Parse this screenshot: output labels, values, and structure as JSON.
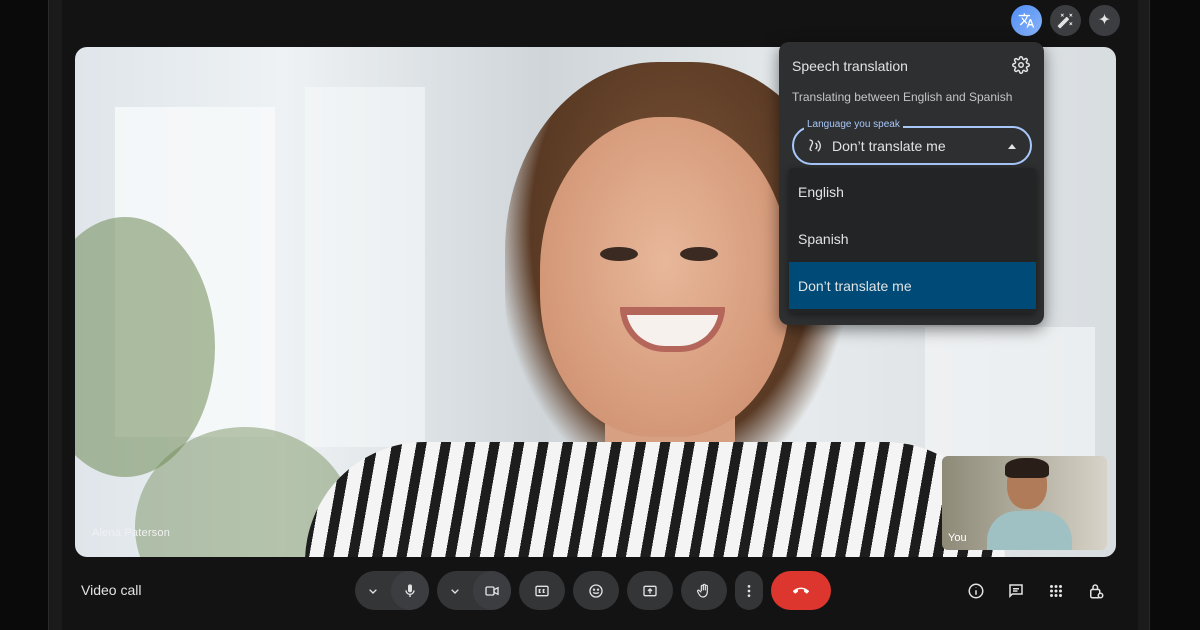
{
  "top_icons": [
    {
      "name": "translate-icon",
      "active": true
    },
    {
      "name": "magic-wand-icon",
      "active": false
    },
    {
      "name": "sparkle-icon",
      "active": false
    }
  ],
  "main_video": {
    "speaker_name": "Alena Paterson"
  },
  "self_view": {
    "label": "You"
  },
  "translation_panel": {
    "title": "Speech translation",
    "subtitle": "Translating between English and Spanish",
    "select_legend": "Language you speak",
    "select_value": "Don’t translate me",
    "options": [
      {
        "label": "English",
        "selected": false
      },
      {
        "label": "Spanish",
        "selected": false
      },
      {
        "label": "Don’t translate me",
        "selected": true
      }
    ]
  },
  "bottom_bar": {
    "meeting_title": "Video call",
    "controls": [
      "microphone-options",
      "microphone",
      "camera-options",
      "camera",
      "captions",
      "emoji-reactions",
      "present-screen",
      "raise-hand",
      "more-options",
      "leave-call"
    ],
    "right_icons": [
      "meeting-info",
      "chat",
      "activities",
      "host-controls"
    ]
  },
  "colors": {
    "accent": "#a8c7fa",
    "selected_option": "#004a77",
    "hangup": "#dc362e",
    "panel_bg": "#2d2f31"
  }
}
